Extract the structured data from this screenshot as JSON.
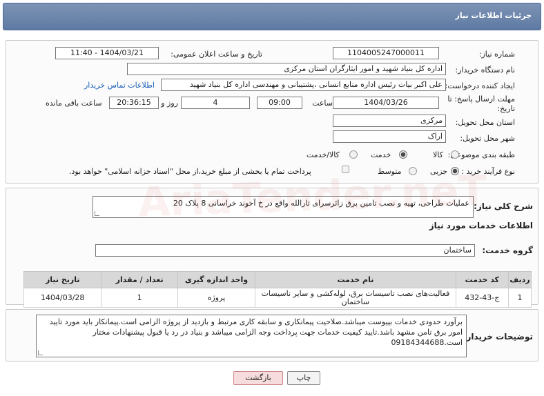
{
  "header": {
    "title": "جزئیات اطلاعات نیاز"
  },
  "form": {
    "need_number_label": "شماره نیاز:",
    "need_number": "1104005247000011",
    "announce_label": "تاریخ و ساعت اعلان عمومی:",
    "announce_value": "1404/03/21 - 11:40",
    "buyer_label": "نام دستگاه خریدار:",
    "buyer_value": "اداره کل بنیاد شهید و امور ایثارگران استان مرکزی",
    "creator_label": "ایجاد کننده درخواست:",
    "creator_value": "علی اکبر بیات رئیس اداره منابع انسانی ،پشتیبانی و مهندسی اداره کل بنیاد شهید",
    "contact_link": "اطلاعات تماس خریدار",
    "deadline_label": "مهلت ارسال پاسخ: تا تاریخ:",
    "deadline_date": "1404/03/26",
    "time_label": "ساعت",
    "deadline_time": "09:00",
    "days_value": "4",
    "days_label": "روز و",
    "remaining_time": "20:36:15",
    "remaining_label": "ساعت باقی مانده",
    "province_label": "استان محل تحویل:",
    "province_value": "مرکزی",
    "city_label": "شهر محل تحویل:",
    "city_value": "اراک",
    "category_label": "طبقه بندی موضوعی:",
    "category_options": [
      "کالا",
      "خدمت",
      "کالا/خدمت"
    ],
    "category_selected": "خدمت",
    "process_label": "نوع فرآیند خرید :",
    "process_options": [
      "جزیی",
      "متوسط"
    ],
    "process_selected": "جزیی",
    "payment_note": "پرداخت تمام یا بخشی از مبلغ خرید،از محل \"اسناد خزانه اسلامی\" خواهد بود."
  },
  "description": {
    "label": "شرح کلی نیاز:",
    "value": "عملیات طراحی، تهیه و نصب تامین برق زائرسرای ثارالله واقع در خ آخوند خراسانی 8 پلاک 20"
  },
  "services": {
    "section_title": "اطلاعات خدمات مورد نیاز",
    "group_label": "گروه خدمت:",
    "group_value": "ساختمان",
    "columns": [
      "ردیف",
      "کد خدمت",
      "نام خدمت",
      "واحد اندازه گیری",
      "تعداد / مقدار",
      "تاریخ نیاز"
    ],
    "rows": [
      {
        "row": "1",
        "code": "ج-43-432",
        "name": "فعالیت‌های نصب تاسیسات برق، لوله‌کشی و سایر تاسیسات ساختمان",
        "unit": "پروژه",
        "qty": "1",
        "date": "1404/03/28"
      }
    ]
  },
  "buyer_notes": {
    "label": "توضیحات خریدار:",
    "value": "برآورد حدودی خدمات بپیوست میباشد.صلاحیت پیمانکاری و سابقه کاری مرتبط و بازدید از پروژه الزامی است.پیمانکار باید مورد تایید امور برق تامن مشهد باشد.تایید کیفیت خدمات جهت پرداخت وجه الزامی میباشد و بنیاد در رد یا قبول پیشنهادات مختار است.09184344688"
  },
  "buttons": {
    "print": "چاپ",
    "back": "بازگشت"
  },
  "watermark": "AriaTender.neT"
}
